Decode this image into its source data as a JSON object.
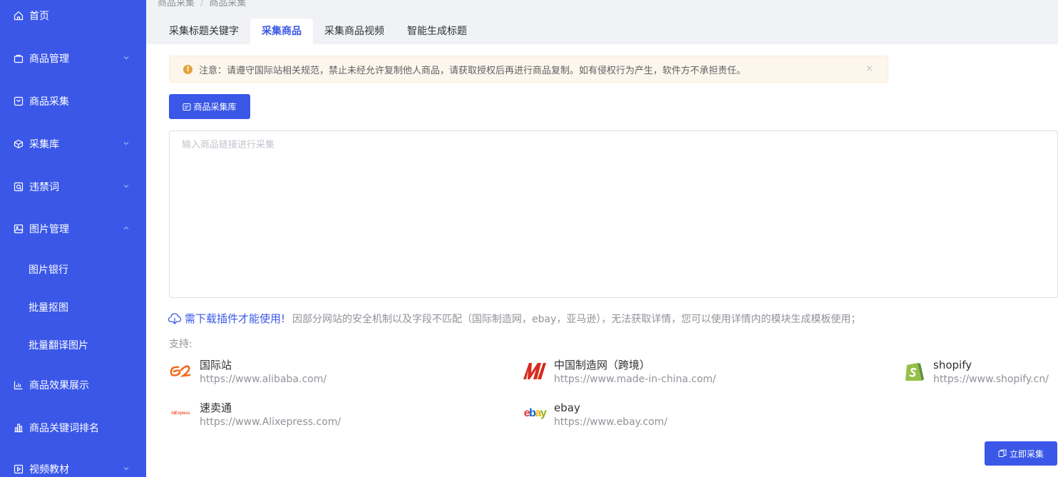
{
  "sidebar": {
    "items": [
      {
        "label": "首页",
        "icon": "home-icon",
        "chevron": "none"
      },
      {
        "label": "商品管理",
        "icon": "bag-icon",
        "chevron": "down"
      },
      {
        "label": "商品采集",
        "icon": "collect-icon",
        "chevron": "none"
      },
      {
        "label": "采集库",
        "icon": "box-icon",
        "chevron": "down"
      },
      {
        "label": "违禁词",
        "icon": "forbidden-icon",
        "chevron": "down"
      },
      {
        "label": "图片管理",
        "icon": "image-icon",
        "chevron": "up"
      },
      {
        "label": "图片银行"
      },
      {
        "label": "批量抠图"
      },
      {
        "label": "批量翻译图片"
      },
      {
        "label": "商品效果展示",
        "icon": "chart-icon",
        "chevron": "none"
      },
      {
        "label": "商品关键词排名",
        "icon": "rank-icon",
        "chevron": "none"
      },
      {
        "label": "视频教材",
        "icon": "video-icon",
        "chevron": "down"
      }
    ]
  },
  "breadcrumb": [
    "商品采集",
    "商品采集"
  ],
  "tabs": [
    {
      "label": "采集标题关键字",
      "active": false
    },
    {
      "label": "采集商品",
      "active": true
    },
    {
      "label": "采集商品视频",
      "active": false
    },
    {
      "label": "智能生成标题",
      "active": false
    }
  ],
  "notice": {
    "text": "注意：请遵守国际站相关规范，禁止未经允许复制他人商品，请获取授权后再进行商品复制。如有侵权行为产生，软件方不承担责任。",
    "close": "×"
  },
  "library_button": {
    "label": "商品采集库"
  },
  "url_input": {
    "placeholder": "输入商品链接进行采集",
    "value": ""
  },
  "plugin": {
    "link": "需下载插件才能使用!",
    "text": "因部分网站的安全机制以及字段不匹配（国际制造网，ebay，亚马逊），无法获取详情，您可以使用详情内的模块生成模板使用；"
  },
  "support_label": "支持:",
  "sites": [
    {
      "name": "国际站",
      "url": "https://www.alibaba.com/",
      "logo": "alibaba-logo"
    },
    {
      "name": "中国制造网（跨境）",
      "url": "https://www.made-in-china.com/",
      "logo": "made-in-china-logo"
    },
    {
      "name": "shopify",
      "url": "https://www.shopify.cn/",
      "logo": "shopify-logo"
    },
    {
      "name": "速卖通",
      "url": "https://www.Alixepress.com/",
      "logo": "aliexpress-logo",
      "logo_text": "AliExpress"
    },
    {
      "name": "ebay",
      "url": "https://www.ebay.com/",
      "logo": "ebay-logo",
      "logo_text": "ebay"
    }
  ],
  "collect_button": {
    "label": "立即采集"
  },
  "colors": {
    "primary": "#3a57e8",
    "notice_bg": "#fdf6ec",
    "warn": "#e6a23c"
  }
}
